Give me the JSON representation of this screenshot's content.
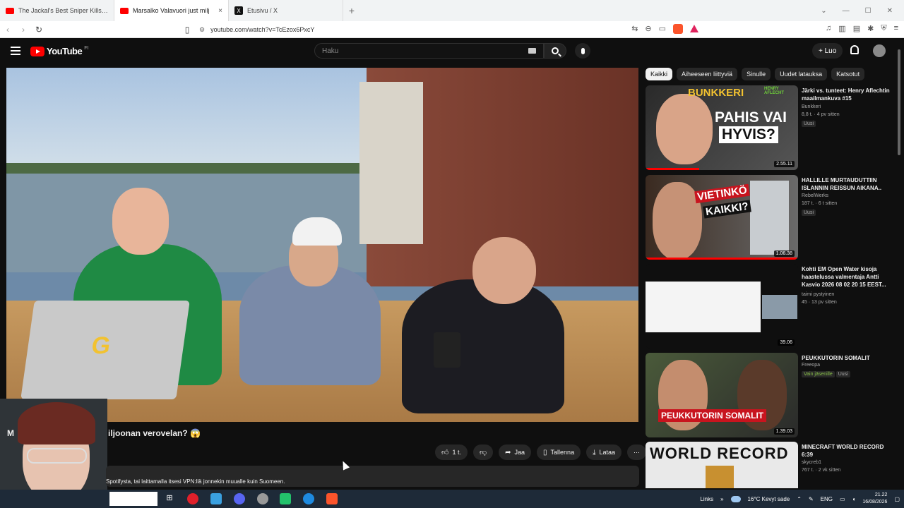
{
  "browser": {
    "tabs": [
      {
        "title": "The Jackal's Best Sniper Kills | The Da",
        "icon": "youtube-icon",
        "active": false
      },
      {
        "title": "Marsalko Valavuori just milj",
        "icon": "youtube-icon",
        "active": true
      },
      {
        "title": "Etusivu / X",
        "icon": "x-icon",
        "active": false
      }
    ],
    "url": "youtube.com/watch?v=TcEzox6PxcY",
    "close_glyph": "×",
    "newtab_glyph": "+"
  },
  "youtube": {
    "logo": "YouTube",
    "logo_sup": "FI",
    "search_placeholder": "Haku",
    "create_label": "+ Luo"
  },
  "video": {
    "title_left": "M",
    "title_right": "iljoonan verovelan? 😱",
    "actions": {
      "like": "1 t.",
      "share": "Jaa",
      "save": "Tallenna",
      "download": "Lataa",
      "more": "⋯"
    },
    "description": "Spotifysta, tai laittamalla itsesi VPN:llä jonnekin muualle kuin Suomeen."
  },
  "sidebar": {
    "chips": [
      "Kaikki",
      "Aiheeseen liittyviä",
      "Sinulle",
      "Uudet latauksa",
      "Katsotut"
    ],
    "recommendations": [
      {
        "title": "Järki vs. tunteet: Henry Aflechtin maailmankuva #15",
        "channel": "Bunkkeri",
        "meta": "8,8 t. · 4 pv sitten",
        "badge": "Uusi",
        "duration": "2.55.11",
        "thumb_text1": "BUNKKERI",
        "thumb_text2": "PAHIS VAI",
        "thumb_text3": "HYVIS?",
        "thumb_text4": "HENRY AFLECHT",
        "progress": 0.35
      },
      {
        "title": "HALLILLE MURTAUDUTTIIN ISLANNIN REISSUN AIKANA..",
        "channel": "RebelWerks",
        "meta": "187 t. · 6 t sitten",
        "badge": "Uusi",
        "duration": "1.06.38",
        "thumb_text1": "VIETINKÖ",
        "thumb_text2": "KAIKKI?",
        "progress": 1.0
      },
      {
        "title": "Kohti EM Open Water kisoja haastelussa valmentaja  Antti Kasvio  2026 08 02 20 15 EEST...",
        "channel": "taimi pystyinen",
        "meta": "45 · 13 pv sitten",
        "duration": "39.06"
      },
      {
        "title": "PEUKKUTORIN SOMALIT",
        "channel": "Freeopa",
        "badge_green": "Vain jäsenille",
        "badge": "Uusi",
        "duration": "1.39.03",
        "thumb_text1": "PEUKKUTORIN SOMALIT"
      },
      {
        "title": "MINECRAFT WORLD RECORD 6:39",
        "channel": "skycreb1",
        "meta": "767 t. · 2 vk sitten",
        "thumb_text1": "WORLD RECORD"
      }
    ]
  },
  "taskbar": {
    "links": "Links",
    "weather": "16°C  Kevyt sade",
    "lang": "ENG",
    "time": "21.22",
    "date": "16/08/2026"
  },
  "colors": {
    "accent": "#ff0000",
    "background": "#0f0f0f",
    "chip": "#272727"
  }
}
